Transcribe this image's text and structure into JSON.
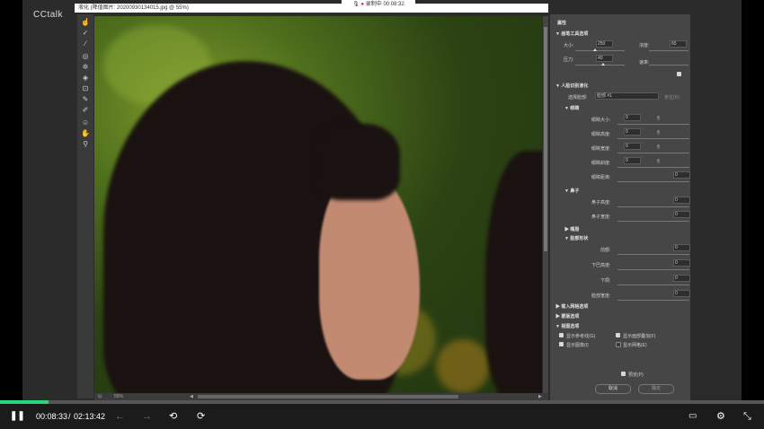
{
  "player": {
    "brand": "CCtalk",
    "recording_text": "录制中 00:08:32",
    "recording_icon": "microphone-icon",
    "current_time": "00:08:33",
    "separator": "/",
    "total_time": "02:13:42",
    "progress_fraction": 0.064,
    "accent_color": "#28d67c"
  },
  "photoshop": {
    "window_title": "液化 (降值图片: 20200930134015.jpg @ 55%)",
    "zoom": "55%",
    "panel": {
      "title": "属性",
      "brush_section": "画笔工具选项",
      "size_label": "大小:",
      "size_value": "250",
      "density_label": "浓度:",
      "density_value": "65",
      "pressure_label": "压力:",
      "pressure_value": "40",
      "rate_label": "速率:",
      "face_section": "人脸识别液化",
      "select_face_label": "选择脸部:",
      "select_face_value": "脸部 #1",
      "reset_label": "复位(R)",
      "eyes_section": "眼睛",
      "eye_rows": [
        "眼睛大小:",
        "眼睛高度:",
        "眼睛宽度:",
        "眼睛斜度:",
        "眼睛距离:"
      ],
      "eye_values": [
        "0",
        "0",
        "0",
        "0",
        "0"
      ],
      "nose_section": "鼻子",
      "nose_rows": [
        "鼻子高度:",
        "鼻子宽度:"
      ],
      "nose_values": [
        "0",
        "0"
      ],
      "mouth_section": "嘴唇",
      "face_shape_section": "脸部形状",
      "face_rows": [
        "前额:",
        "下巴高度:",
        "下颌:",
        "脸部宽度:"
      ],
      "face_values": [
        "0",
        "0",
        "0",
        "0"
      ],
      "mesh_section": "载入网格选项",
      "mask_section": "蒙版选项",
      "view_section": "视图选项",
      "view_options": [
        "显示参考线(G)",
        "显示面部叠加(F)",
        "显示图像(I)",
        "显示网格(E)"
      ],
      "preview_label": "预览(P)",
      "cancel_label": "取消",
      "ok_label": "确定"
    }
  }
}
